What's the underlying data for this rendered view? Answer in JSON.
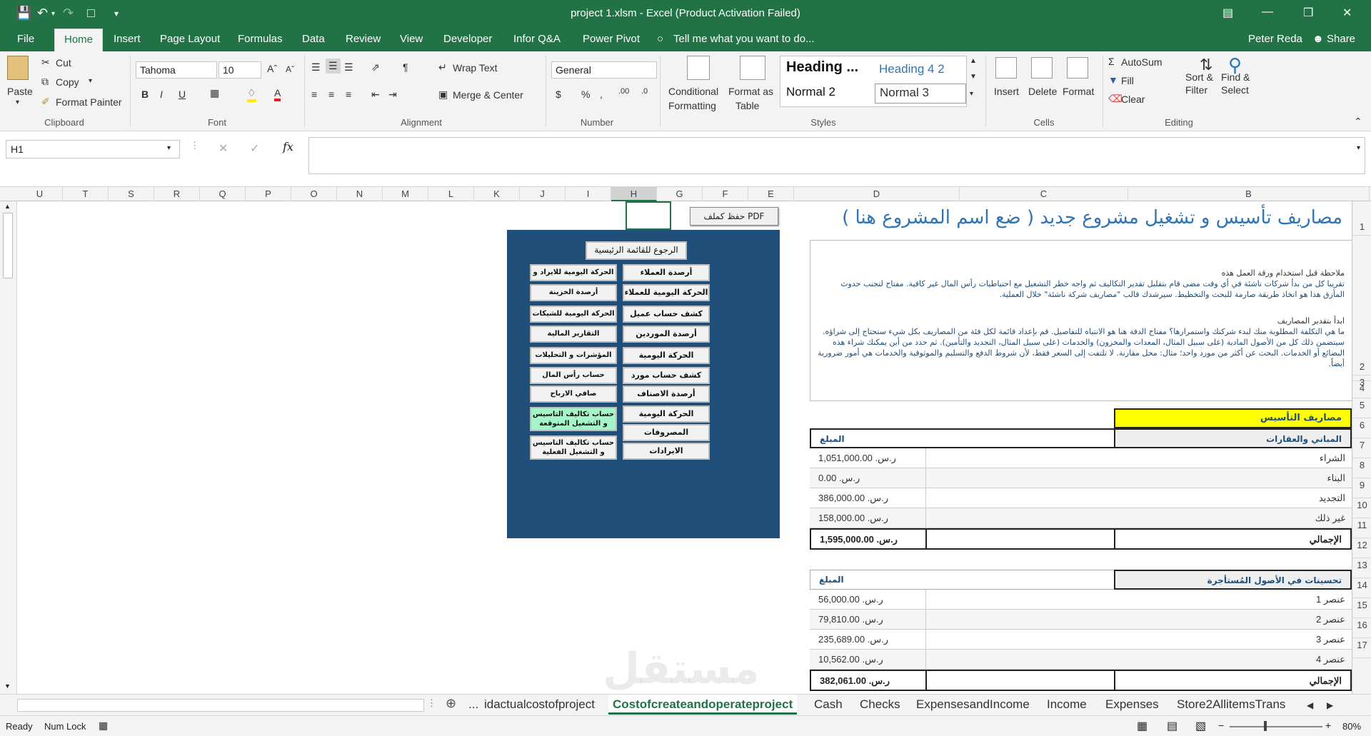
{
  "window": {
    "title": "project 1.xlsm - Excel (Product Activation Failed)"
  },
  "menu": [
    "File",
    "Home",
    "Insert",
    "Page Layout",
    "Formulas",
    "Data",
    "Review",
    "View",
    "Developer",
    "Infor Q&A",
    "Power Pivot"
  ],
  "tell_me": "Tell me what you want to do...",
  "user": "Peter Reda",
  "share": "Share",
  "ribbon": {
    "paste": "Paste",
    "cut": "Cut",
    "copy": "Copy",
    "format_painter": "Format Painter",
    "clipboard": "Clipboard",
    "font_name": "Tahoma",
    "font_size": "10",
    "font": "Font",
    "wrap_text": "Wrap Text",
    "merge_center": "Merge & Center",
    "alignment": "Alignment",
    "number_format": "General",
    "number": "Number",
    "conditional": "Conditional",
    "formatting": "Formatting",
    "format_as": "Format as",
    "table": "Table",
    "heading_dots": "Heading ...",
    "heading42": "Heading 4 2",
    "normal2": "Normal 2",
    "normal3": "Normal 3",
    "styles": "Styles",
    "insert": "Insert",
    "delete": "Delete",
    "format": "Format",
    "cells": "Cells",
    "autosum": "AutoSum",
    "fill": "Fill",
    "clear": "Clear",
    "sort_filter_1": "Sort &",
    "sort_filter_2": "Filter",
    "find_1": "Find &",
    "find_2": "Select",
    "editing": "Editing"
  },
  "formula_bar": {
    "name_box": "H1",
    "fx": "fx",
    "value": ""
  },
  "columns": [
    "U",
    "T",
    "S",
    "R",
    "Q",
    "P",
    "O",
    "N",
    "M",
    "L",
    "K",
    "J",
    "I",
    "H",
    "G",
    "F",
    "E",
    "D",
    "C",
    "B",
    "A"
  ],
  "rows": [
    "1",
    "2",
    "3",
    "4",
    "5",
    "6",
    "7",
    "8",
    "9",
    "10",
    "11",
    "12",
    "13",
    "14",
    "15",
    "16",
    "17"
  ],
  "sheet": {
    "pdf_button": "حفظ كملف PDF",
    "main_title": "مصاريف تأسيس و تشغيل مشروع جديد ( ضع اسم المشروع هنا )",
    "note_title": "ملاحظة قبل استخدام ورقة العمل هذه",
    "note_p1": "تقريبا كل من بدأ شركات ناشئة في أي وقت مضى قام بتقليل تقدير التكاليف ثم واجه خطر التشغيل مع احتياطيات رأس المال غير كافية. مفتاح لتجنب حدوث المأزق هذا هو اتخاذ طريقة صارمة للبحث والتخطيط. سيرشدك قالب \"مصاريف شركة ناشئة\" خلال العملية.",
    "note_title2": "ابدأ بتقدير المصاريف",
    "note_p2": "ما هي التكلفة المطلوبة منك لبدء شركتك واستمرارها؟ مفتاح الدقة هنا هو الانتباه للتفاصيل. قم بإعداد قائمة لكل فئة من المصاريف بكل شيء ستحتاج إلى شراؤه. سيتضمن ذلك كل من الأصول المادية (على سبيل المثال، المعدات والمخزون) والخدمات (على سبيل المثال، التجديد والتأمين). ثم حدد من أين يمكنك شراء هذه البضائع أو الخدمات. البحث عن أكثر من مورد واحد؛ مثال: محل مقارنة. لا تلتفت إلى السعر فقط، لأن شروط الدفع والتسليم والموثوقية والخدمات هي أمور ضرورية أيضاً.",
    "section_title": "مصاريف التأسيس",
    "table1": {
      "header": "المباني والعقارات",
      "amount_hdr": "المبلغ",
      "rows": [
        {
          "label": "الشراء",
          "amount": "ر.س. 1,051,000.00"
        },
        {
          "label": "البناء",
          "amount": "ر.س. 0.00"
        },
        {
          "label": "التجديد",
          "amount": "ر.س. 386,000.00"
        },
        {
          "label": "غير ذلك",
          "amount": "ر.س. 158,000.00"
        }
      ],
      "total_label": "الإجمالي",
      "total": "ر.س. 1,595,000.00"
    },
    "table2": {
      "header": "تحسينات في الأصول المُستأجرة",
      "amount_hdr": "المبلغ",
      "rows": [
        {
          "label": "عنصر 1",
          "amount": "ر.س. 56,000.00"
        },
        {
          "label": "عنصر 2",
          "amount": "ر.س. 79,810.00"
        },
        {
          "label": "عنصر 3",
          "amount": "ر.س. 235,689.00"
        },
        {
          "label": "عنصر 4",
          "amount": "ر.س. 10,562.00"
        }
      ],
      "total_label": "الإجمالي",
      "total": "ر.س. 382,061.00"
    }
  },
  "panel": {
    "back": "الرجوع للقائمة الرئيسية",
    "right": [
      "أرصدة العملاء",
      "الحركة اليومية للعملاء",
      "كشف حساب عميل",
      "أرصدة الموردين",
      "الحركة اليومية للموردين",
      "كشف حساب مورد",
      "أرصدة الاصناف",
      "الحركة اليومية للاصناف",
      "المصروفات",
      "الايرادات"
    ],
    "left": [
      "الحركة اليومية للايراد و المصروف",
      "أرصدة الخزينة",
      "الحركة اليومية للشيكات",
      "التقارير المالية",
      "المؤشرات و التحليلات المالية",
      "حساب رأس المال",
      "صافي الارباح",
      "حساب تكاليف التاسيس و التشغيل المتوقعة",
      "حساب تكاليف التاسيس و التشغيل الفعلية"
    ],
    "bg": "#1f4e79",
    "highlight": "#a6f5c9"
  },
  "tabs": [
    "...",
    "idactualcostofproject",
    "Costofcreateandoperateproject",
    "Cash",
    "Checks",
    "ExpensesandIncome",
    "Income",
    "Expenses",
    "Store2AllitemsTrans"
  ],
  "active_tab": "Costofcreateandoperateproject",
  "status": {
    "ready": "Ready",
    "numlock": "Num Lock",
    "zoom": "80%"
  },
  "watermark": "مستقل"
}
